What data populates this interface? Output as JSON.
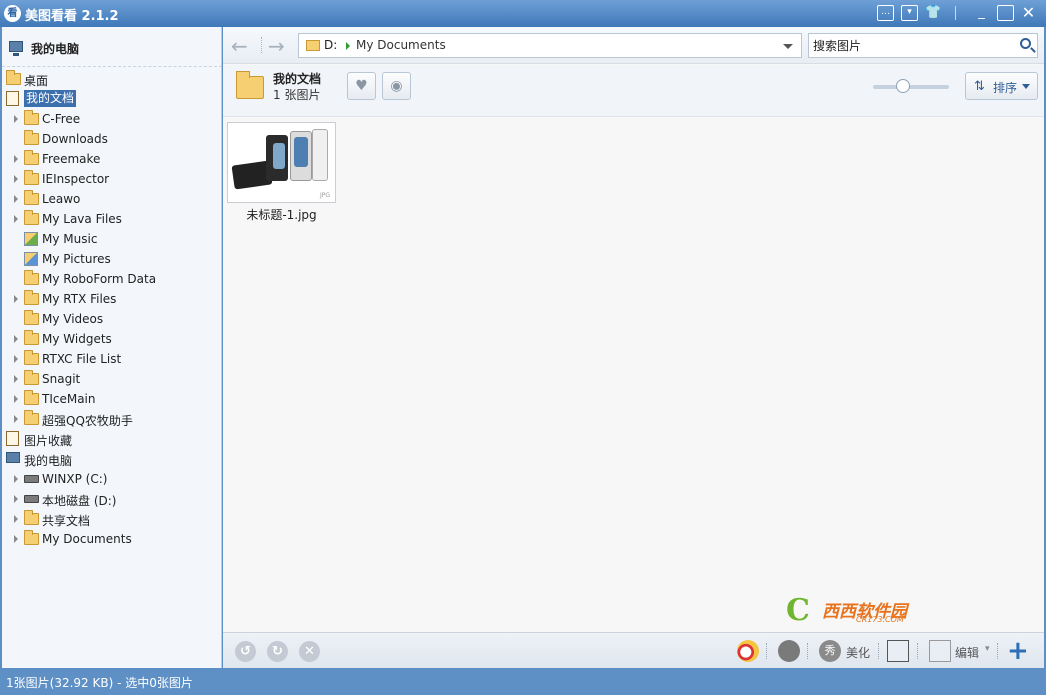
{
  "window": {
    "title": "美图看看 2.1.2",
    "logo_char": "看",
    "controls": [
      "feedback-icon",
      "menu-icon",
      "skin-icon",
      "minimize-icon",
      "maximize-icon",
      "close-icon"
    ]
  },
  "sidebar": {
    "header": "我的电脑",
    "items": [
      {
        "label": "桌面",
        "level": 0,
        "icon": "folder-icon"
      },
      {
        "label": "我的文档",
        "level": 0,
        "icon": "documents-icon",
        "selected": true
      },
      {
        "label": "C-Free",
        "level": 1,
        "icon": "folder-icon",
        "expandable": true
      },
      {
        "label": "Downloads",
        "level": 1,
        "icon": "folder-icon"
      },
      {
        "label": "Freemake",
        "level": 1,
        "icon": "folder-icon",
        "expandable": true
      },
      {
        "label": "IEInspector",
        "level": 1,
        "icon": "folder-icon",
        "expandable": true
      },
      {
        "label": "Leawo",
        "level": 1,
        "icon": "folder-icon",
        "expandable": true
      },
      {
        "label": "My Lava Files",
        "level": 1,
        "icon": "folder-icon",
        "expandable": true
      },
      {
        "label": "My Music",
        "level": 1,
        "icon": "music-folder-icon"
      },
      {
        "label": "My Pictures",
        "level": 1,
        "icon": "pictures-folder-icon"
      },
      {
        "label": "My RoboForm Data",
        "level": 1,
        "icon": "folder-icon"
      },
      {
        "label": "My RTX Files",
        "level": 1,
        "icon": "folder-icon",
        "expandable": true
      },
      {
        "label": "My Videos",
        "level": 1,
        "icon": "folder-icon"
      },
      {
        "label": "My Widgets",
        "level": 1,
        "icon": "folder-icon",
        "expandable": true
      },
      {
        "label": "RTXC File List",
        "level": 1,
        "icon": "folder-icon",
        "expandable": true
      },
      {
        "label": "Snagit",
        "level": 1,
        "icon": "folder-icon",
        "expandable": true
      },
      {
        "label": "TIceMain",
        "level": 1,
        "icon": "folder-icon",
        "expandable": true
      },
      {
        "label": "超强QQ农牧助手",
        "level": 1,
        "icon": "folder-icon",
        "expandable": true
      },
      {
        "label": "图片收藏",
        "level": 0,
        "icon": "favorites-icon"
      },
      {
        "label": "我的电脑",
        "level": 0,
        "icon": "computer-icon"
      },
      {
        "label": "WINXP (C:)",
        "level": 1,
        "icon": "drive-icon",
        "expandable": true
      },
      {
        "label": "本地磁盘 (D:)",
        "level": 1,
        "icon": "drive-icon",
        "expandable": true
      },
      {
        "label": "共享文档",
        "level": 1,
        "icon": "folder-icon",
        "expandable": true
      },
      {
        "label": "My Documents",
        "level": 1,
        "icon": "folder-icon",
        "expandable": true
      }
    ]
  },
  "navbar": {
    "drive": "D:",
    "path_folder": "My Documents",
    "search_placeholder": "搜索图片"
  },
  "folder_info": {
    "title": "我的文档",
    "count": "1 张图片",
    "sort_label": "排序",
    "zoom_fraction": 0.4
  },
  "files": [
    {
      "name": "未标题-1.jpg",
      "ext_badge": "JPG"
    }
  ],
  "watermark": {
    "letter": "C",
    "text": "西西软件园",
    "sub": "CR173.COM"
  },
  "bottom_toolbar": {
    "beautify_label": "美化",
    "edit_label": "编辑"
  },
  "status": {
    "text": "1张图片(32.92 KB) - 选中0张图片"
  },
  "colors": {
    "titlebar": "#3f78b8",
    "selection": "#3c6fae",
    "statusbar": "#5e90c6",
    "folder": "#f6cf72"
  }
}
